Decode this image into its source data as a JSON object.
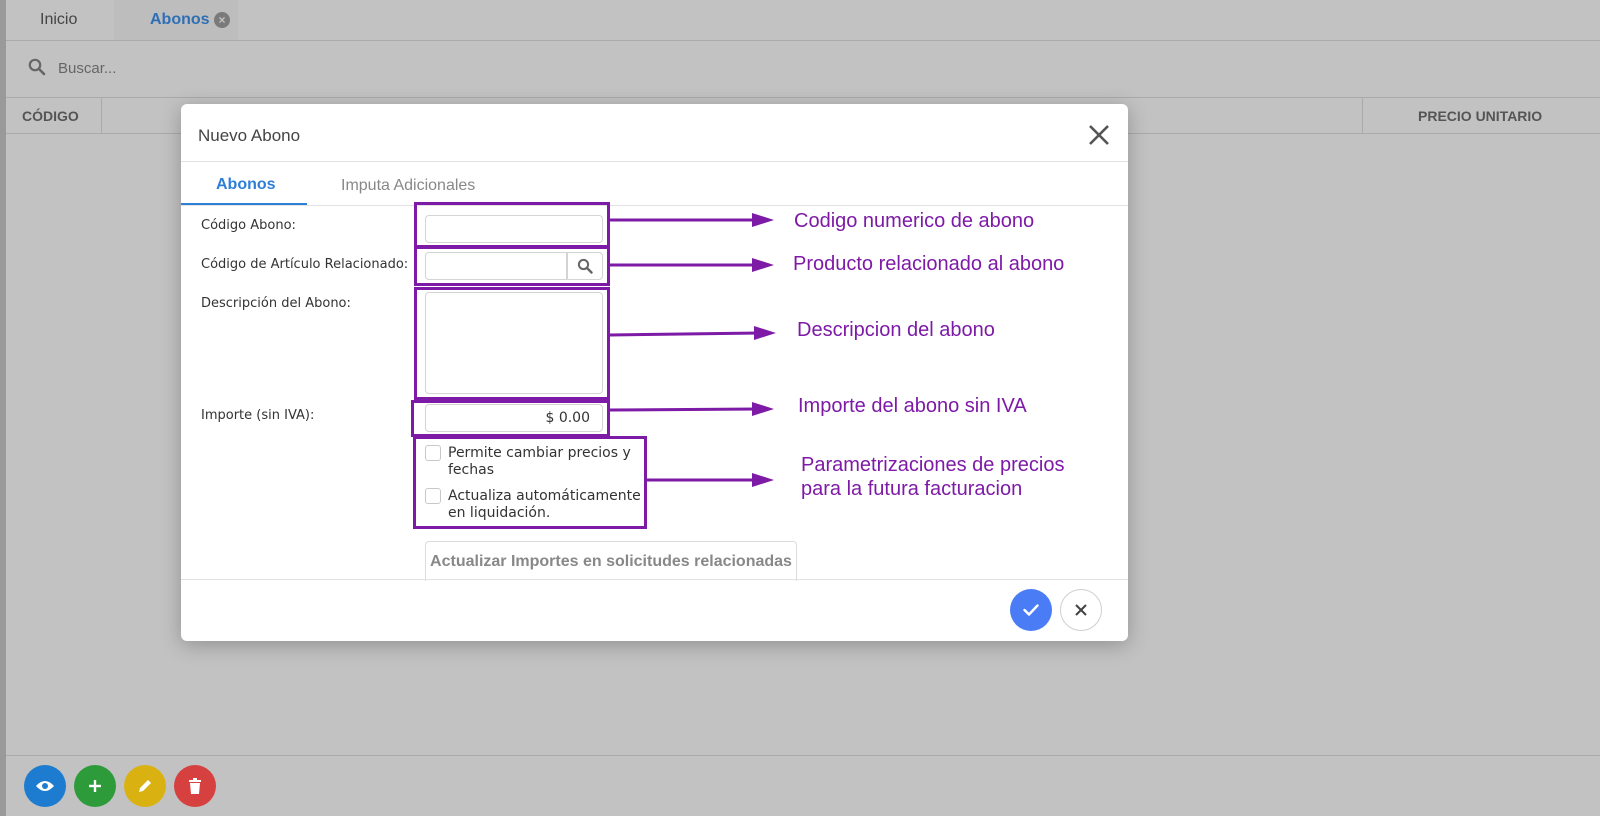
{
  "tabs": [
    {
      "label": "Inicio"
    },
    {
      "label": "Abonos"
    }
  ],
  "search": {
    "placeholder": "Buscar..."
  },
  "grid": {
    "columns": [
      "CÓDIGO",
      "PRECIO UNITARIO"
    ]
  },
  "modal": {
    "title": "Nuevo Abono",
    "tabs": [
      {
        "label": "Abonos"
      },
      {
        "label": "Imputa Adicionales"
      }
    ],
    "fields": {
      "codigo_label": "Código Abono:",
      "articulo_label": "Código de Artículo Relacionado:",
      "descripcion_label": "Descripción del Abono:",
      "importe_label": "Importe (sin IVA):",
      "importe_value": "$ 0.00"
    },
    "checkboxes": [
      {
        "label": "Permite cambiar precios y fechas",
        "checked": false
      },
      {
        "label": "Actualiza automáticamente en liquidación.",
        "checked": false
      }
    ],
    "update_button": "Actualizar Importes en solicitudes relacionadas"
  },
  "annotations": [
    "Codigo numerico de abono",
    "Producto relacionado al abono",
    "Descripcion del abono",
    "Importe del abono sin IVA",
    "Parametrizaciones de precios",
    "para la futura facturacion"
  ],
  "colors": {
    "accent": "#2e7fd8",
    "confirm": "#4a7df5",
    "annotation": "#7d1aa6",
    "fab_view": "#1d7ccf",
    "fab_add": "#2e9b3a",
    "fab_edit": "#d9b212",
    "fab_delete": "#d6403f"
  },
  "icons": [
    "close-tab-icon",
    "search-icon",
    "close-icon",
    "magnifier-icon",
    "check-icon",
    "eye-icon",
    "plus-icon",
    "pencil-icon",
    "trash-icon"
  ]
}
